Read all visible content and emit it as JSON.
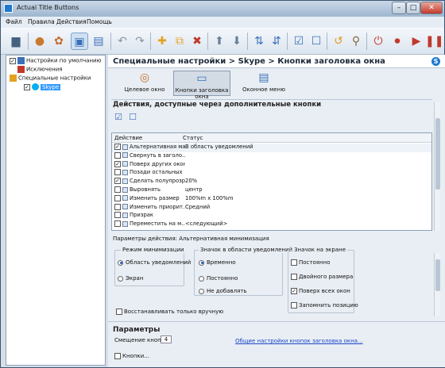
{
  "window": {
    "title": "Actual Title Buttons"
  },
  "menu": [
    "Файл",
    "Правила",
    "Действия",
    "Помощь"
  ],
  "tree": {
    "items": [
      {
        "label": "Настройки по умолчанию",
        "checked": true
      },
      {
        "label": "Исключения"
      },
      {
        "label": "Специальные настройки"
      },
      {
        "label": "Skype",
        "checked": true,
        "selected": true
      }
    ]
  },
  "main": {
    "breadcrumb": "Специальные настройки > Skype > Кнопки заголовка окна",
    "views": [
      {
        "label": "Целевое окно"
      },
      {
        "label": "Кнопки заголовка окна",
        "selected": true
      },
      {
        "label": "Оконное меню"
      }
    ],
    "actions_title": "Действия, доступные через дополнительные кнопки",
    "table": {
      "headers": [
        "Действие",
        "Статус"
      ],
      "rows": [
        {
          "checked": true,
          "action": "Альтернативная ма...",
          "status": "В область уведомлений"
        },
        {
          "checked": false,
          "action": "Свернуть в заголо...",
          "status": ""
        },
        {
          "checked": true,
          "action": "Поверх других окон",
          "status": ""
        },
        {
          "checked": false,
          "action": "Позади остальных",
          "status": ""
        },
        {
          "checked": true,
          "action": "Сделать полупрозр...",
          "status": "20%"
        },
        {
          "checked": false,
          "action": "Выровнять",
          "status": "центр"
        },
        {
          "checked": false,
          "action": "Изменить размер",
          "status": "100%m x 100%m"
        },
        {
          "checked": false,
          "action": "Изменить приорит...",
          "status": "Средний"
        },
        {
          "checked": false,
          "action": "Призрак",
          "status": ""
        },
        {
          "checked": false,
          "action": "Переместить на м...",
          "status": "<следующий>"
        }
      ]
    },
    "params_action_label": "Параметры действия: Альтернативная минимизация",
    "mode_group": {
      "title": "Режим минимизации",
      "options": [
        {
          "label": "Область уведомлений",
          "selected": true
        },
        {
          "label": "Экран",
          "selected": false
        }
      ]
    },
    "tray_group": {
      "title": "Значок в области уведомлений",
      "options": [
        {
          "label": "Временно",
          "selected": true
        },
        {
          "label": "Постоянно",
          "selected": false
        },
        {
          "label": "Не добавлять",
          "selected": false
        }
      ]
    },
    "screen_group": {
      "title": "Значок на экране",
      "options": [
        {
          "label": "Постоянно",
          "checked": false
        },
        {
          "label": "Двойного размера",
          "checked": false
        },
        {
          "label": "Поверх всех окон",
          "checked": true
        },
        {
          "label": "Запомнить позицию",
          "checked": false
        }
      ]
    },
    "restore_manual": "Восстанавливать только вручную",
    "params_title": "Параметры",
    "offset_label": "Смещение кнопок:",
    "offset_value": "4",
    "general_link": "Общие настройки кнопок заголовка окна...",
    "partial_bottom_text": "Кнопки..."
  }
}
